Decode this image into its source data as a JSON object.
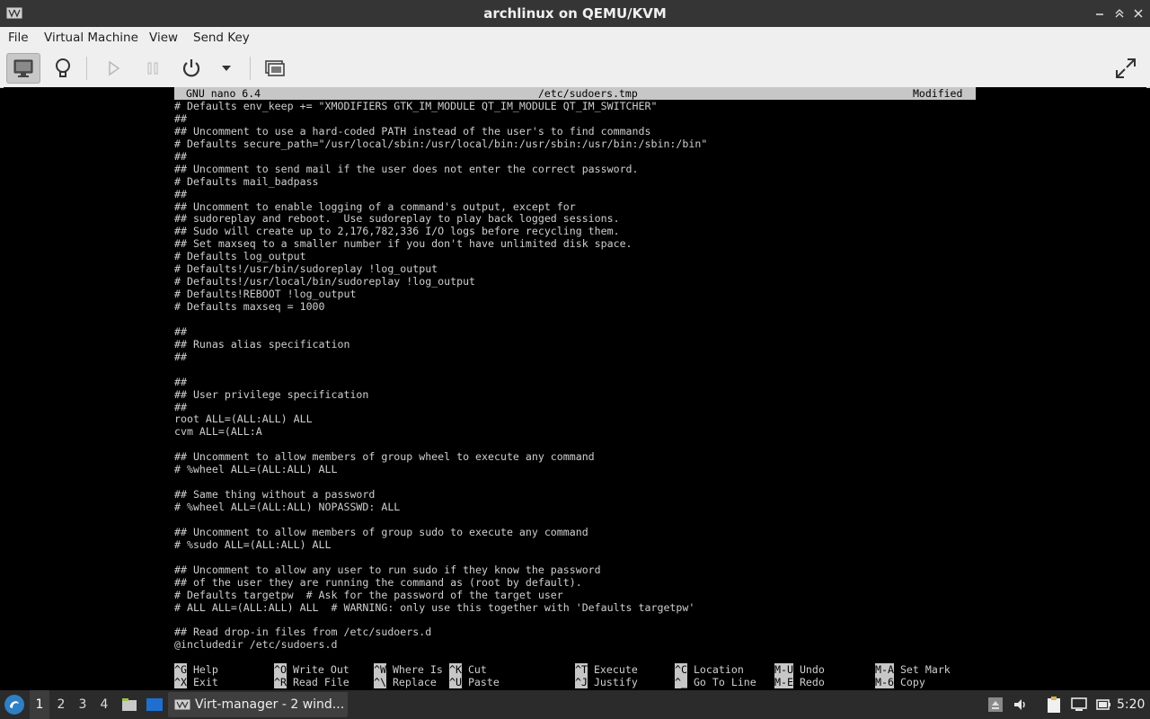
{
  "window": {
    "title": "archlinux on QEMU/KVM"
  },
  "menu": {
    "file": "File",
    "virtual_machine": "Virtual Machine",
    "view": "View",
    "send_key": "Send Key"
  },
  "toolbar": {
    "icons": [
      "monitor-icon",
      "lightbulb-icon",
      "play-icon",
      "pause-icon",
      "power-icon",
      "chevron-down-icon",
      "screenshot-icon",
      "fullscreen-icon"
    ]
  },
  "nano": {
    "version": "GNU nano 6.4",
    "filename": "/etc/sudoers.tmp",
    "status": "Modified",
    "lines": [
      "# Defaults env_keep += \"XMODIFIERS GTK_IM_MODULE QT_IM_MODULE QT_IM_SWITCHER\"",
      "##",
      "## Uncomment to use a hard-coded PATH instead of the user's to find commands",
      "# Defaults secure_path=\"/usr/local/sbin:/usr/local/bin:/usr/sbin:/usr/bin:/sbin:/bin\"",
      "##",
      "## Uncomment to send mail if the user does not enter the correct password.",
      "# Defaults mail_badpass",
      "##",
      "## Uncomment to enable logging of a command's output, except for",
      "## sudoreplay and reboot.  Use sudoreplay to play back logged sessions.",
      "## Sudo will create up to 2,176,782,336 I/O logs before recycling them.",
      "## Set maxseq to a smaller number if you don't have unlimited disk space.",
      "# Defaults log_output",
      "# Defaults!/usr/bin/sudoreplay !log_output",
      "# Defaults!/usr/local/bin/sudoreplay !log_output",
      "# Defaults!REBOOT !log_output",
      "# Defaults maxseq = 1000",
      "",
      "##",
      "## Runas alias specification",
      "##",
      "",
      "##",
      "## User privilege specification",
      "##",
      "root ALL=(ALL:ALL) ALL",
      "cvm ALL=(ALL:A",
      "",
      "## Uncomment to allow members of group wheel to execute any command",
      "# %wheel ALL=(ALL:ALL) ALL",
      "",
      "## Same thing without a password",
      "# %wheel ALL=(ALL:ALL) NOPASSWD: ALL",
      "",
      "## Uncomment to allow members of group sudo to execute any command",
      "# %sudo ALL=(ALL:ALL) ALL",
      "",
      "## Uncomment to allow any user to run sudo if they know the password",
      "## of the user they are running the command as (root by default).",
      "# Defaults targetpw  # Ask for the password of the target user",
      "# ALL ALL=(ALL:ALL) ALL  # WARNING: only use this together with 'Defaults targetpw'",
      "",
      "## Read drop-in files from /etc/sudoers.d",
      "@includedir /etc/sudoers.d"
    ],
    "shortcuts": [
      {
        "key": "^G",
        "label": "Help"
      },
      {
        "key": "^X",
        "label": "Exit"
      },
      {
        "key": "^O",
        "label": "Write Out"
      },
      {
        "key": "^R",
        "label": "Read File"
      },
      {
        "key": "^W",
        "label": "Where Is"
      },
      {
        "key": "^\\",
        "label": "Replace"
      },
      {
        "key": "^K",
        "label": "Cut"
      },
      {
        "key": "^U",
        "label": "Paste"
      },
      {
        "key": "^T",
        "label": "Execute"
      },
      {
        "key": "^J",
        "label": "Justify"
      },
      {
        "key": "^C",
        "label": "Location"
      },
      {
        "key": "^_",
        "label": "Go To Line"
      },
      {
        "key": "M-U",
        "label": "Undo"
      },
      {
        "key": "M-E",
        "label": "Redo"
      },
      {
        "key": "M-A",
        "label": "Set Mark"
      },
      {
        "key": "M-6",
        "label": "Copy"
      }
    ]
  },
  "taskbar": {
    "workspaces": [
      "1",
      "2",
      "3",
      "4"
    ],
    "task_label": "Virt-manager - 2 wind...",
    "clock": "5:20"
  }
}
